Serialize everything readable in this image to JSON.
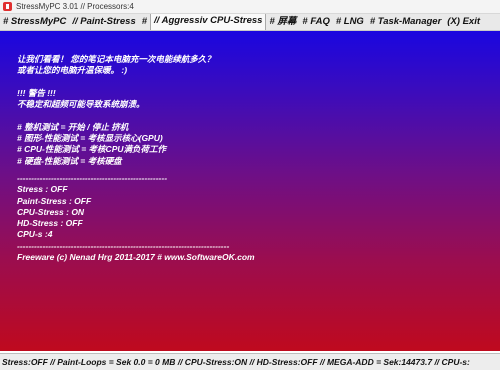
{
  "window": {
    "title": "StressMyPC 3.01 // Processors:4"
  },
  "tabs": [
    {
      "label": "# StressMyPC"
    },
    {
      "label": "// Paint-Stress"
    },
    {
      "label": "#"
    },
    {
      "label": "// Aggressiv CPU-Stress"
    },
    {
      "label": "# 屏幕"
    },
    {
      "label": "# FAQ"
    },
    {
      "label": "# LNG"
    },
    {
      "label": "# Task-Manager"
    },
    {
      "label": "(X) Exit"
    }
  ],
  "console": {
    "intro1": "让我们看看！ 您的笔记本电脑充一次电能续航多久？",
    "intro2": "或者让您的电脑升温保暖。 :)",
    "warn_title": "!!! 警告 !!!",
    "warn_text": "不稳定和超频可能导致系统崩溃。",
    "hint1": "# 整机测试 = 开始 / 停止 挤机",
    "hint2": "# 图形-性能测试 = 考核显示核心(GPU)",
    "hint3": "# CPU-性能测试 = 考核CPU满负荷工作",
    "hint4": "# 硬盘-性能测试 = 考核硬盘",
    "sep1": "-----------------------------------------------------",
    "stress": "Stress : OFF",
    "paint_stress": "Paint-Stress : OFF",
    "cpu_stress": "CPU-Stress : ON",
    "hd_stress": "HD-Stress : OFF",
    "cpus": "CPU-s :4",
    "sep2": "---------------------------------------------------------------------------",
    "footer": "Freeware (c) Nenad Hrg 2011-2017 # www.SoftwareOK.com"
  },
  "statusbar": {
    "text": "Stress:OFF // Paint-Loops = Sek 0.0 = 0 MB // CPU-Stress:ON // HD-Stress:OFF // MEGA-ADD = Sek:14473.7 // CPU-s:"
  }
}
